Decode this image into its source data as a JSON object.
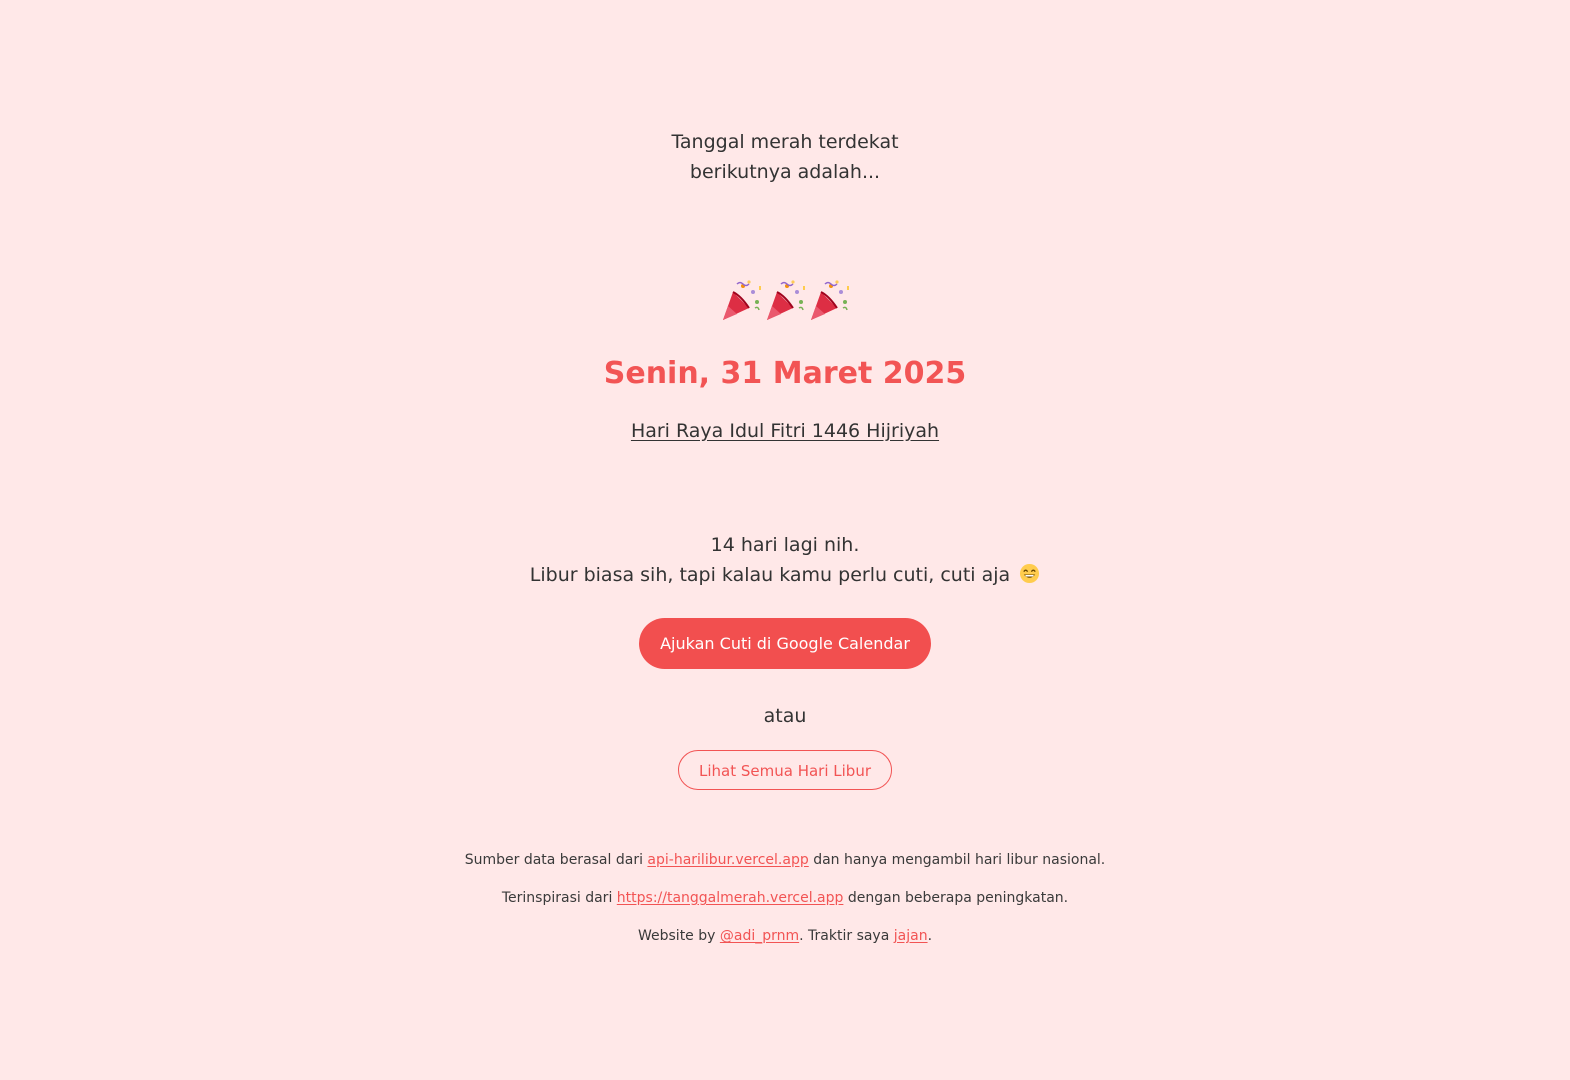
{
  "intro": {
    "line1": "Tanggal merah terdekat",
    "line2": "berikutnya adalah..."
  },
  "celebration": {
    "icons": [
      "party-popper-icon",
      "party-popper-icon",
      "party-popper-icon"
    ]
  },
  "holiday": {
    "date": "Senin, 31 Maret 2025",
    "name": "Hari Raya Idul Fitri 1446 Hijriyah"
  },
  "countdown": {
    "days_text": "14 hari lagi nih.",
    "message": "Libur biasa sih, tapi kalau kamu perlu cuti, cuti aja",
    "emoji": "grinning-face-icon"
  },
  "actions": {
    "primary_label": "Ajukan Cuti di Google Calendar",
    "or_text": "atau",
    "secondary_label": "Lihat Semua Hari Libur"
  },
  "footer": {
    "source_prefix": "Sumber data berasal dari ",
    "source_link": "api-harilibur.vercel.app",
    "source_suffix": " dan hanya mengambil hari libur nasional.",
    "inspired_prefix": "Terinspirasi dari ",
    "inspired_link": "https://tanggalmerah.vercel.app",
    "inspired_suffix": " dengan beberapa peningkatan.",
    "credit_prefix": "Website by ",
    "credit_link": "@adi_prnm",
    "credit_middle": ". Traktir saya ",
    "treat_link": "jajan",
    "credit_suffix": "."
  },
  "colors": {
    "background": "#ffe8e8",
    "accent": "#f25454",
    "text": "#333333"
  }
}
